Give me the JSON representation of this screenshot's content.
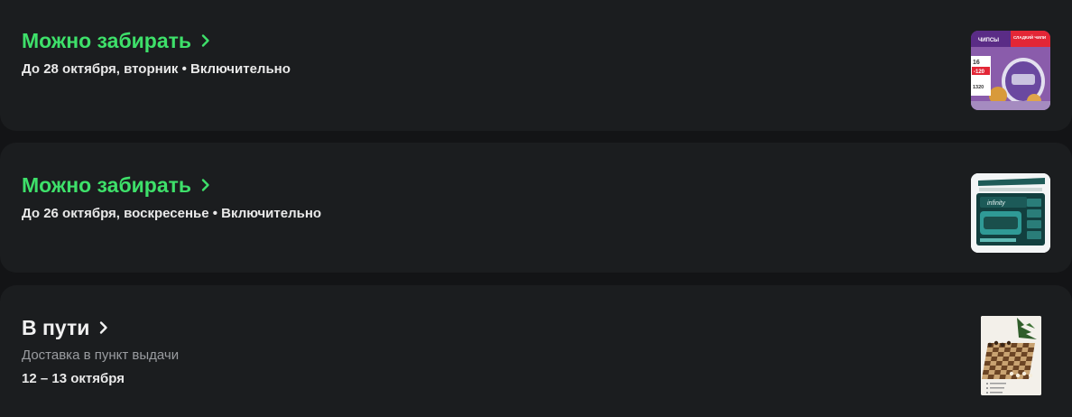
{
  "orders": [
    {
      "title": "Можно забирать",
      "subtitle": "До 28 октября, вторник • Включительно",
      "status_color": "#3ee06a",
      "chevron_icon": "chevron-right-icon",
      "thumbnail": {
        "chips": "ЧИПСЫ",
        "chips_flavor": "СЛАДКИЙ ЧИЛИ",
        "count": "16",
        "price": "-120",
        "small": "1320"
      }
    },
    {
      "title": "Можно забирать",
      "subtitle": "До 26 октября, воскресенье • Включительно",
      "status_color": "#3ee06a",
      "chevron_icon": "chevron-right-icon",
      "thumbnail": {
        "brand": "infinity"
      }
    },
    {
      "title": "В пути",
      "subtitle": "Доставка в пункт выдачи",
      "dates": "12 – 13 октября",
      "status_color": "#f1f1f1",
      "chevron_icon": "chevron-right-icon"
    }
  ]
}
